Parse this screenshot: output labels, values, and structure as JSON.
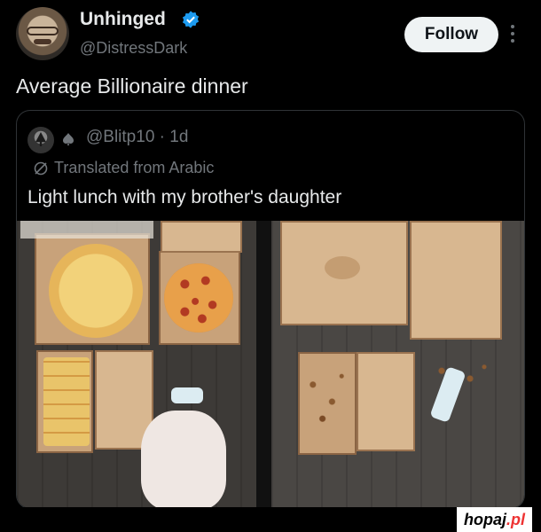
{
  "author": {
    "name": "Unhinged",
    "handle": "@DistressDark",
    "verified": true,
    "avatar_icon": "avatar-man-glasses"
  },
  "actions": {
    "follow_label": "Follow",
    "more_icon": "more-vertical-icon"
  },
  "tweet": {
    "text": "Average Billionaire dinner"
  },
  "quoted": {
    "handle_meta": "@Blitp10 · 1d",
    "translated_label": "Translated from Arabic",
    "text": "Light lunch with my brother's daughter"
  },
  "watermark": {
    "text": "hopaj",
    "dot": ".pl"
  },
  "colors": {
    "background": "#000000",
    "verified_blue": "#1d9bf0",
    "muted": "#71767b",
    "follow_bg": "#eff3f4"
  }
}
